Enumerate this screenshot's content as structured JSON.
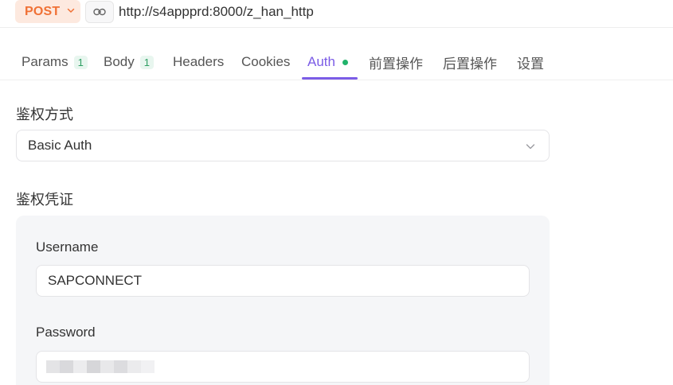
{
  "request": {
    "method": "POST",
    "url": "http://s4appprd:8000/z_han_http"
  },
  "tabs": [
    {
      "label": "Params",
      "badge": "1"
    },
    {
      "label": "Body",
      "badge": "1"
    },
    {
      "label": "Headers"
    },
    {
      "label": "Cookies"
    },
    {
      "label": "Auth",
      "active": true
    },
    {
      "label": "前置操作"
    },
    {
      "label": "后置操作"
    },
    {
      "label": "设置"
    }
  ],
  "auth": {
    "method_label": "鉴权方式",
    "method_value": "Basic Auth",
    "credentials_label": "鉴权凭证",
    "username_label": "Username",
    "username_value": "SAPCONNECT",
    "password_label": "Password"
  },
  "icons": {
    "method_dropdown": "chevron-down-icon",
    "link": "link-icon",
    "auth_dropdown": "chevron-down-icon",
    "auth_status": "status-dot-icon"
  },
  "colors": {
    "method_text": "#f07135",
    "method_bg": "#fde9df",
    "accent": "#7b5ce6",
    "badge_text": "#2f9e63",
    "status_dot": "#21b36b"
  }
}
